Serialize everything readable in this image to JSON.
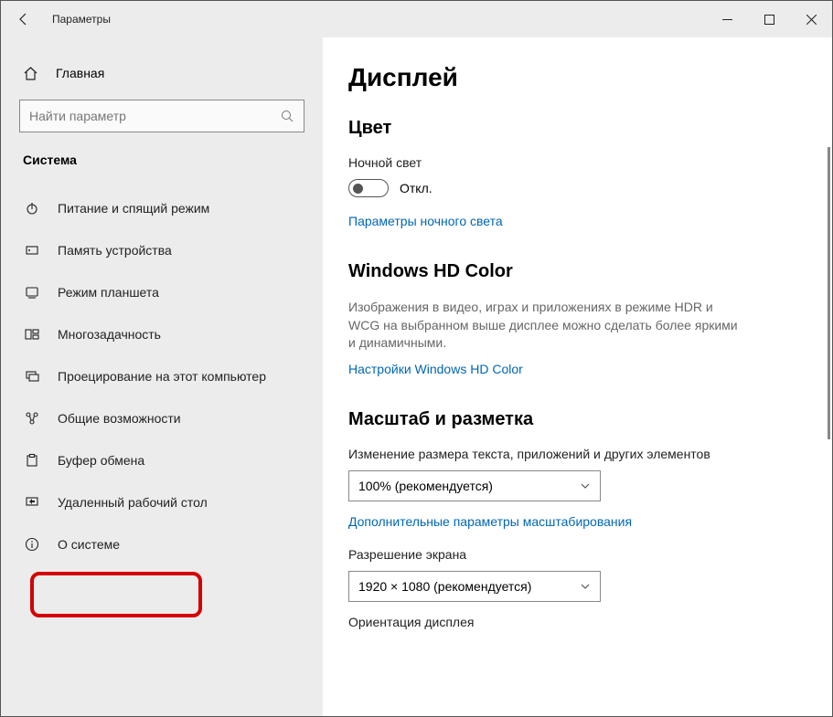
{
  "window": {
    "title": "Параметры"
  },
  "sidebar": {
    "home": "Главная",
    "search_placeholder": "Найти параметр",
    "section": "Система",
    "items": [
      {
        "label": "Питание и спящий режим"
      },
      {
        "label": "Память устройства"
      },
      {
        "label": "Режим планшета"
      },
      {
        "label": "Многозадачность"
      },
      {
        "label": "Проецирование на этот компьютер"
      },
      {
        "label": "Общие возможности"
      },
      {
        "label": "Буфер обмена"
      },
      {
        "label": "Удаленный рабочий стол"
      },
      {
        "label": "О системе"
      }
    ]
  },
  "main": {
    "title": "Дисплей",
    "color": {
      "heading": "Цвет",
      "night_label": "Ночной свет",
      "toggle_state": "Откл.",
      "night_link": "Параметры ночного света"
    },
    "hdcolor": {
      "heading": "Windows HD Color",
      "desc": "Изображения в видео, играх и приложениях в режиме HDR и WCG на выбранном выше дисплее можно сделать более яркими и динамичными.",
      "link": "Настройки Windows HD Color"
    },
    "scale": {
      "heading": "Масштаб и разметка",
      "scale_label": "Изменение размера текста, приложений и других элементов",
      "scale_value": "100% (рекомендуется)",
      "scale_link": "Дополнительные параметры масштабирования",
      "res_label": "Разрешение экрана",
      "res_value": "1920 × 1080 (рекомендуется)",
      "orient_label": "Ориентация дисплея"
    }
  }
}
